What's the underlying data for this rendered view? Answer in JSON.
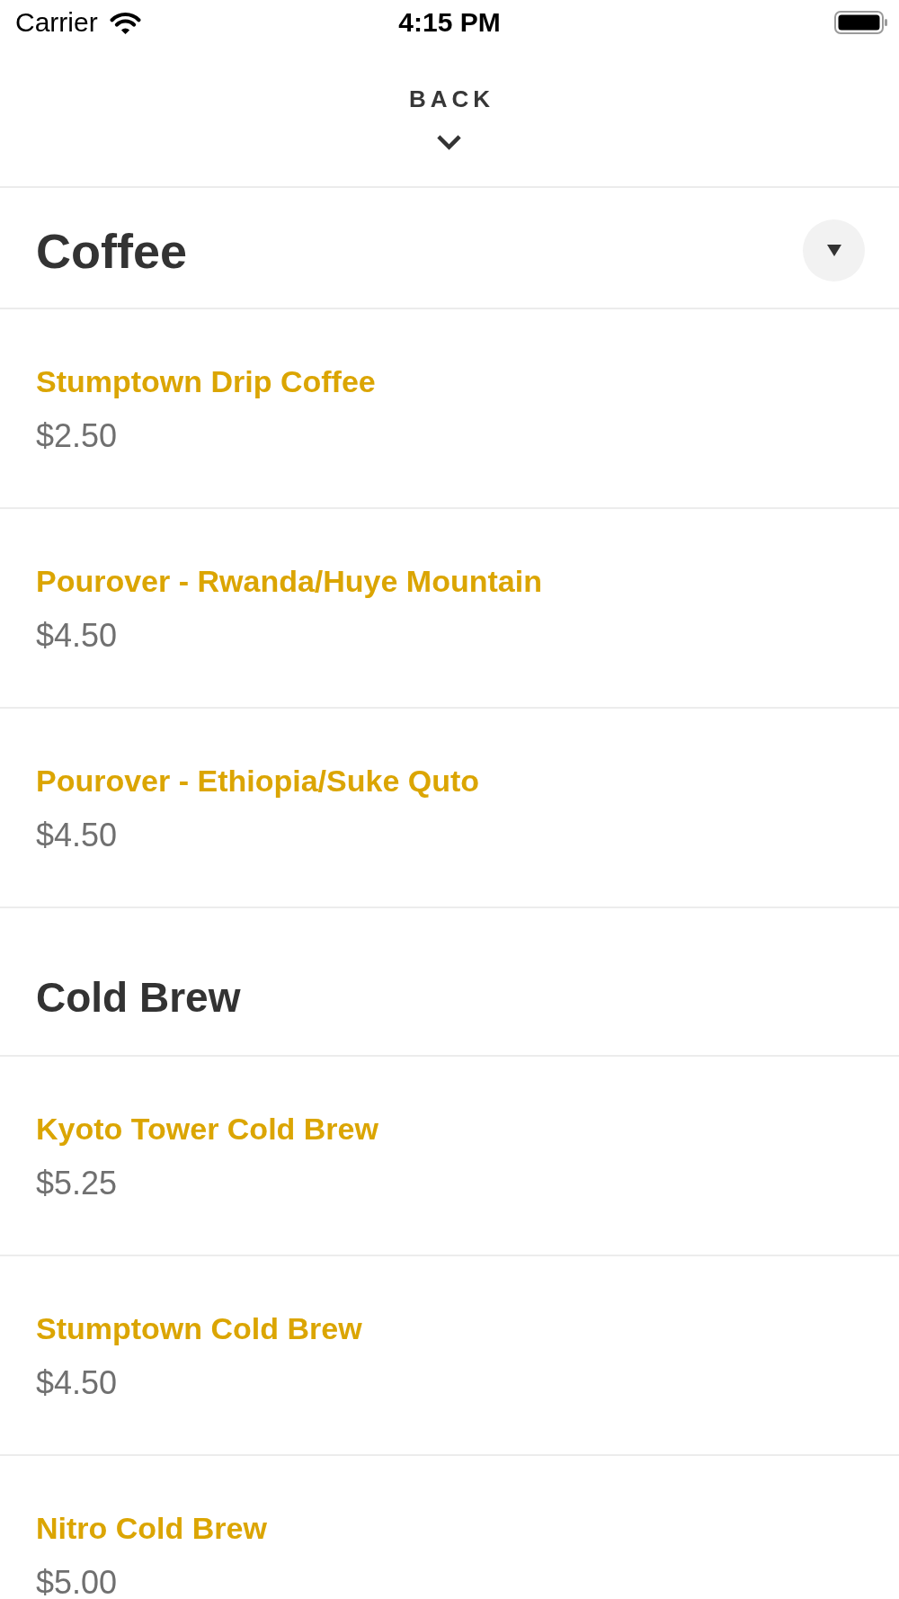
{
  "status_bar": {
    "carrier": "Carrier",
    "time": "4:15 PM"
  },
  "header": {
    "back_label": "BACK"
  },
  "sections": [
    {
      "kind": "picker",
      "title": "Coffee",
      "items": [
        {
          "name": "Stumptown Drip Coffee",
          "price": "$2.50"
        },
        {
          "name": "Pourover - Rwanda/Huye Mountain",
          "price": "$4.50"
        },
        {
          "name": "Pourover - Ethiopia/Suke Quto",
          "price": "$4.50"
        }
      ]
    },
    {
      "kind": "heading",
      "title": "Cold Brew",
      "items": [
        {
          "name": "Kyoto Tower Cold Brew",
          "price": "$5.25"
        },
        {
          "name": "Stumptown Cold Brew",
          "price": "$4.50"
        },
        {
          "name": "Nitro Cold Brew",
          "price": "$5.00"
        }
      ]
    }
  ]
}
